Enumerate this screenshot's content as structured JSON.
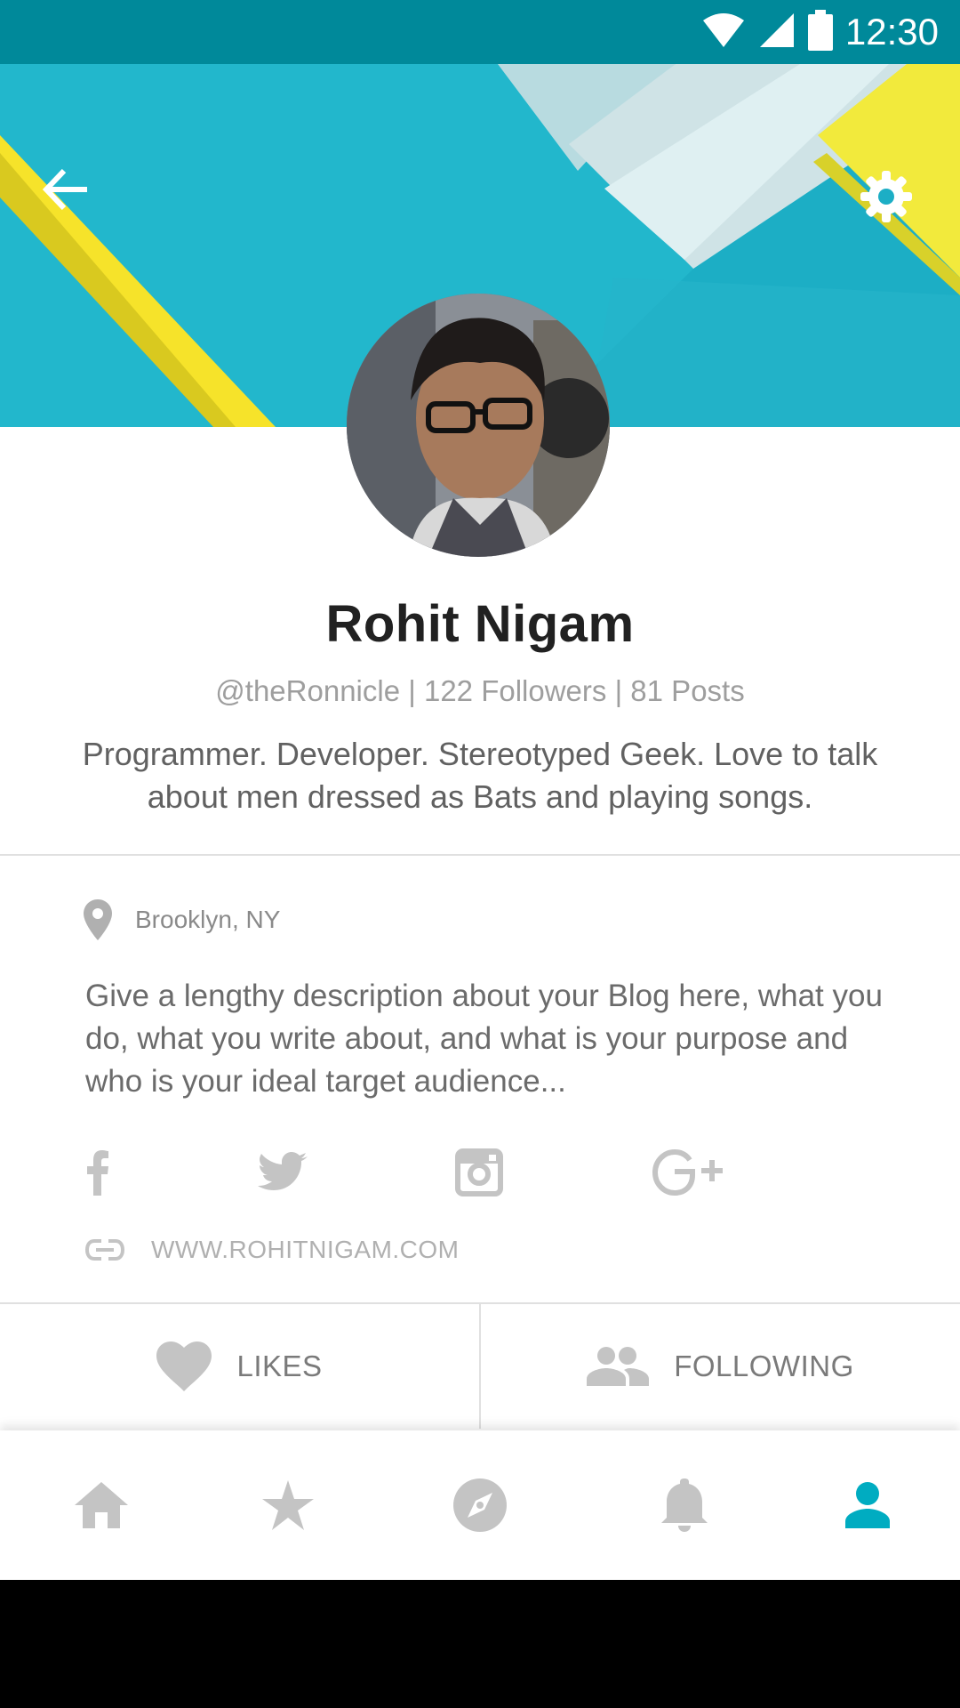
{
  "status_bar": {
    "time": "12:30"
  },
  "header": {
    "back_icon": "arrow-back-icon",
    "settings_icon": "gear-icon"
  },
  "profile": {
    "name": "Rohit Nigam",
    "meta": "@theRonnicle | 122 Followers | 81 Posts",
    "bio": "Programmer. Developer. Stereotyped Geek. Love to talk about men dressed as Bats and playing songs."
  },
  "about": {
    "location": "Brooklyn, NY",
    "description": "Give a lengthy description about your Blog here, what you do, what you write about, and what is your purpose and who is your ideal target audience...",
    "social": [
      "facebook-icon",
      "twitter-icon",
      "instagram-icon",
      "google-plus-icon"
    ],
    "website": "WWW.ROHITNIGAM.COM"
  },
  "tabs": {
    "likes": "LIKES",
    "following": "FOLLOWING"
  },
  "bottom_nav": {
    "items": [
      "home-icon",
      "star-icon",
      "explore-icon",
      "bell-icon",
      "person-icon"
    ],
    "active": "person-icon"
  },
  "colors": {
    "status_bar": "#00899a",
    "banner": "#1aaec5",
    "accent": "#00acc1",
    "inactive_icon": "#c4c4c4"
  }
}
